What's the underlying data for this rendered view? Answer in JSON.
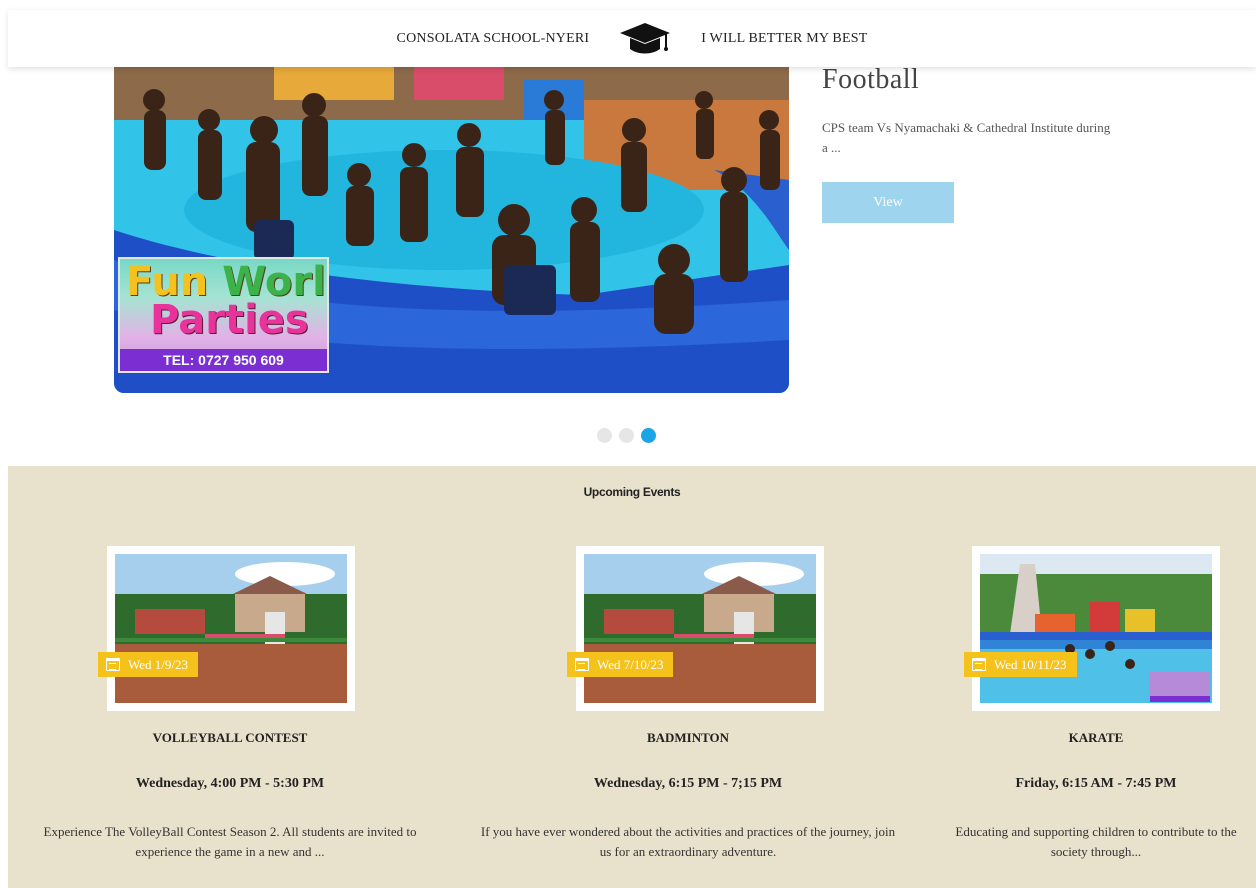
{
  "header": {
    "school_name": "CONSOLATA SCHOOL-NYERI",
    "logo_icon": "graduation-cap-icon",
    "motto": "I WILL BETTER MY BEST"
  },
  "slider": {
    "image_sign": {
      "word1": "Fun",
      "word2": "World",
      "word3": "Parties",
      "phone": "TEL: 0727 950 609"
    },
    "title": "Football",
    "text": "CPS team Vs Nyamachaki & Cathedral Institute during a ...",
    "button_label": "View",
    "dots": [
      false,
      false,
      true
    ],
    "accent_color": "#1aa6e4"
  },
  "events": {
    "title": "Upcoming Events",
    "background": "#e8e1cb",
    "badge_color": "#f5c21b",
    "items": [
      {
        "date": "Wed 1/9/23",
        "name": "VOLLEYBALL CONTEST",
        "time": "Wednesday, 4:00 PM - 5:30 PM",
        "desc": "Experience The VolleyBall Contest Season 2. All students are invited to experience the game in a new and ..."
      },
      {
        "date": "Wed 7/10/23",
        "name": "BADMINTON",
        "time": "Wednesday, 6:15 PM - 7;15 PM",
        "desc": "If you have ever wondered about the activities and practices of the journey, join us for an extraordinary adventure."
      },
      {
        "date": "Wed 10/11/23",
        "name": "KARATE",
        "time": "Friday, 6:15 AM - 7:45 PM",
        "desc": "Educating and supporting children to contribute to the society through..."
      }
    ]
  }
}
